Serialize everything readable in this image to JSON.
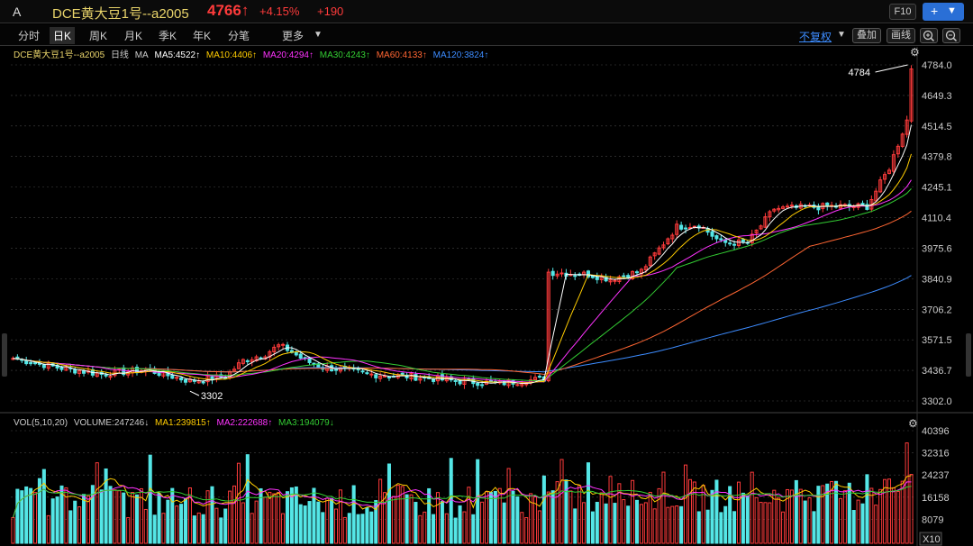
{
  "header": {
    "market": "A",
    "symbol": "DCE黄大豆1号--a2005",
    "price": "4766",
    "price_arrow": "↑",
    "change_pct": "+4.15%",
    "change": "+190",
    "f10_label": "F10",
    "add_label": "+",
    "dropdown_label": "▼"
  },
  "tabs": [
    {
      "label": "分时"
    },
    {
      "label": "日K"
    },
    {
      "label": "周K"
    },
    {
      "label": "月K"
    },
    {
      "label": "季K"
    },
    {
      "label": "年K"
    },
    {
      "label": "分笔"
    },
    {
      "label": "更多"
    }
  ],
  "more_arrow": "▼",
  "toolbar": {
    "fuquan": "不复权",
    "fuquan_arrow": "▼",
    "overlay": "叠加",
    "draw": "画线"
  },
  "main_legend": {
    "symbol": "DCE黄大豆1号--a2005",
    "period": "日线",
    "ma": "MA",
    "ma5": "MA5:4522↑",
    "ma10": "MA10:4406↑",
    "ma20": "MA20:4294↑",
    "ma30": "MA30:4243↑",
    "ma60": "MA60:4133↑",
    "ma120": "MA120:3824↑"
  },
  "vol_legend": {
    "vol": "VOL(5,10,20)",
    "volume": "VOLUME:247246↓",
    "ma1": "MA1:239815↑",
    "ma2": "MA2:222688↑",
    "ma3": "MA3:194079↓"
  },
  "zoom_label": "X10",
  "colors": {
    "up": "#ff3b3b",
    "down": "#54e6e6",
    "ma5": "#ffffff",
    "ma10": "#ffcc00",
    "ma20": "#ff33ff",
    "ma30": "#33cc33",
    "ma60": "#ff6633",
    "ma120": "#3d8cff",
    "axis_text": "#cccccc"
  },
  "chart_data": {
    "type": "candlestick",
    "price_axis": {
      "ticks": [
        "4784.0",
        "4649.3",
        "4514.5",
        "4379.8",
        "4245.1",
        "4110.4",
        "3975.6",
        "3840.9",
        "3706.2",
        "3571.5",
        "3436.7",
        "3302.0"
      ],
      "range": [
        3302,
        4784
      ]
    },
    "volume_axis": {
      "ticks": [
        "40396",
        "32316",
        "24237",
        "16158",
        "8079"
      ],
      "range": [
        0,
        40396
      ]
    },
    "annotations": {
      "high": "4784",
      "low": "3302"
    },
    "last_close": 4766,
    "anchors": [
      [
        0,
        3490
      ],
      [
        10,
        3450
      ],
      [
        20,
        3420
      ],
      [
        30,
        3440
      ],
      [
        40,
        3390
      ],
      [
        48,
        3410
      ],
      [
        52,
        3480
      ],
      [
        57,
        3510
      ],
      [
        60,
        3545
      ],
      [
        62,
        3530
      ],
      [
        66,
        3480
      ],
      [
        70,
        3450
      ],
      [
        75,
        3440
      ],
      [
        80,
        3420
      ],
      [
        90,
        3410
      ],
      [
        100,
        3390
      ],
      [
        110,
        3380
      ],
      [
        120,
        3400
      ],
      [
        121,
        3870
      ],
      [
        130,
        3860
      ],
      [
        135,
        3840
      ],
      [
        142,
        3875
      ],
      [
        150,
        4070
      ],
      [
        155,
        4080
      ],
      [
        160,
        4000
      ],
      [
        166,
        4000
      ],
      [
        172,
        4150
      ],
      [
        185,
        4160
      ],
      [
        193,
        4160
      ],
      [
        198,
        4330
      ],
      [
        202,
        4540
      ],
      [
        203,
        4766
      ]
    ]
  }
}
